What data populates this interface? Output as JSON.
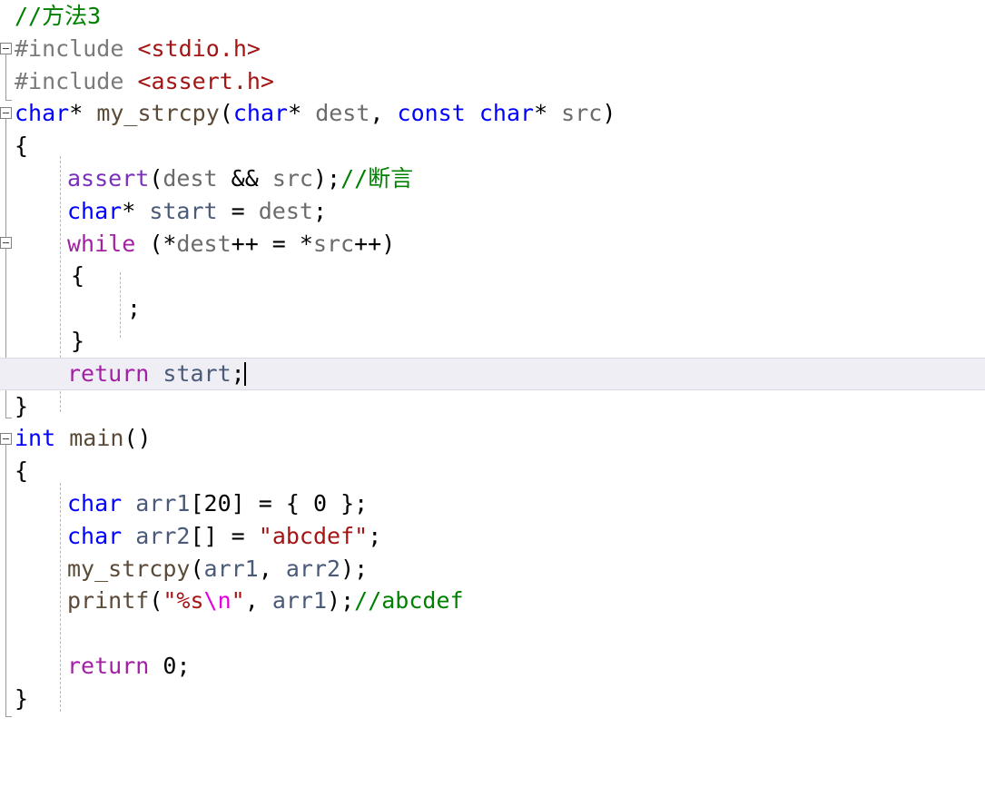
{
  "editor": {
    "language": "C",
    "background_color": "#ffffff",
    "current_line_highlight_color": "#eeeef4",
    "current_line_number": 12,
    "caret_visible": true,
    "colors": {
      "keyword_type": "#0000ff",
      "keyword_control": "#a31fa3",
      "macro": "#7b2fbe",
      "comment": "#008000",
      "string": "#a31515",
      "escape": "#e000e0",
      "function": "#5b4a38",
      "identifier": "#6b6b6b",
      "variable": "#4a5a78",
      "preprocessor": "#7a7a7a",
      "plain": "#000000"
    }
  },
  "code": {
    "lines": [
      {
        "n": 1,
        "indent": 0,
        "text": "//方法3"
      },
      {
        "n": 2,
        "indent": 0,
        "text": "#include <stdio.h>"
      },
      {
        "n": 3,
        "indent": 0,
        "text": "#include <assert.h>"
      },
      {
        "n": 4,
        "indent": 0,
        "text": "char* my_strcpy(char* dest, const char* src)"
      },
      {
        "n": 5,
        "indent": 0,
        "text": "{"
      },
      {
        "n": 6,
        "indent": 1,
        "text": "assert(dest && src);//断言"
      },
      {
        "n": 7,
        "indent": 1,
        "text": "char* start = dest;"
      },
      {
        "n": 8,
        "indent": 1,
        "text": "while (*dest++ = *src++)"
      },
      {
        "n": 9,
        "indent": 1,
        "text": "{"
      },
      {
        "n": 10,
        "indent": 2,
        "text": ";"
      },
      {
        "n": 11,
        "indent": 1,
        "text": "}"
      },
      {
        "n": 12,
        "indent": 1,
        "text": "return start;"
      },
      {
        "n": 13,
        "indent": 0,
        "text": "}"
      },
      {
        "n": 14,
        "indent": 0,
        "text": "int main()"
      },
      {
        "n": 15,
        "indent": 0,
        "text": "{"
      },
      {
        "n": 16,
        "indent": 1,
        "text": "char arr1[20] = { 0 };"
      },
      {
        "n": 17,
        "indent": 1,
        "text": "char arr2[] = \"abcdef\";"
      },
      {
        "n": 18,
        "indent": 1,
        "text": "my_strcpy(arr1, arr2);"
      },
      {
        "n": 19,
        "indent": 1,
        "text": "printf(\"%s\\n\", arr1);//abcdef"
      },
      {
        "n": 20,
        "indent": 1,
        "text": ""
      },
      {
        "n": 21,
        "indent": 1,
        "text": "return 0;"
      },
      {
        "n": 22,
        "indent": 0,
        "text": "}"
      }
    ],
    "tokens": {
      "l1_comment": "//方法3",
      "l2_pp": "#include ",
      "l2_header": "<stdio.h>",
      "l3_pp": "#include ",
      "l3_header": "<assert.h>",
      "l4_type1": "char",
      "l4_star1": "* ",
      "l4_fn": "my_strcpy",
      "l4_open": "(",
      "l4_type2": "char",
      "l4_star2": "* ",
      "l4_p1": "dest",
      "l4_comma": ", ",
      "l4_const": "const",
      "l4_sp": " ",
      "l4_type3": "char",
      "l4_star3": "* ",
      "l4_p2": "src",
      "l4_close": ")",
      "l5_brace": "{",
      "l6_macro": "assert",
      "l6_open": "(",
      "l6_a1": "dest",
      "l6_amp": " && ",
      "l6_a2": "src",
      "l6_close": ");",
      "l6_comment": "//断言",
      "l7_type": "char",
      "l7_star": "* ",
      "l7_var": "start",
      "l7_eq": " = ",
      "l7_val": "dest",
      "l7_semi": ";",
      "l8_ctrl": "while",
      "l8_rest": " (*",
      "l8_a": "dest",
      "l8_mid": "++ = *",
      "l8_b": "src",
      "l8_end": "++)",
      "l9_brace": "{",
      "l10_semi": ";",
      "l11_brace": "}",
      "l12_ctrl": "return",
      "l12_sp": " ",
      "l12_var": "start",
      "l12_semi": ";",
      "l13_brace": "}",
      "l14_type": "int",
      "l14_sp": " ",
      "l14_fn": "main",
      "l14_parens": "()",
      "l15_brace": "{",
      "l16_type": "char",
      "l16_sp": " ",
      "l16_var": "arr1",
      "l16_rest": "[20] = { 0 };",
      "l17_type": "char",
      "l17_sp": " ",
      "l17_var": "arr2",
      "l17_mid": "[] = ",
      "l17_str": "\"abcdef\"",
      "l17_semi": ";",
      "l18_fn": "my_strcpy",
      "l18_open": "(",
      "l18_a1": "arr1",
      "l18_comma": ", ",
      "l18_a2": "arr2",
      "l18_close": ");",
      "l19_fn": "printf",
      "l19_open": "(",
      "l19_strA": "\"%s",
      "l19_esc": "\\n",
      "l19_strB": "\"",
      "l19_comma": ", ",
      "l19_arg": "arr1",
      "l19_close": ");",
      "l19_comment": "//abcdef",
      "l21_ctrl": "return",
      "l21_sp": " ",
      "l21_num": "0",
      "l21_semi": ";",
      "l22_brace": "}"
    }
  },
  "outlining": {
    "regions": [
      {
        "name": "includes-region",
        "expanded": true
      },
      {
        "name": "my-strcpy-function-region",
        "expanded": true
      },
      {
        "name": "while-loop-region",
        "expanded": true
      },
      {
        "name": "main-function-region",
        "expanded": true
      }
    ],
    "marker_glyph": "minus-box"
  }
}
